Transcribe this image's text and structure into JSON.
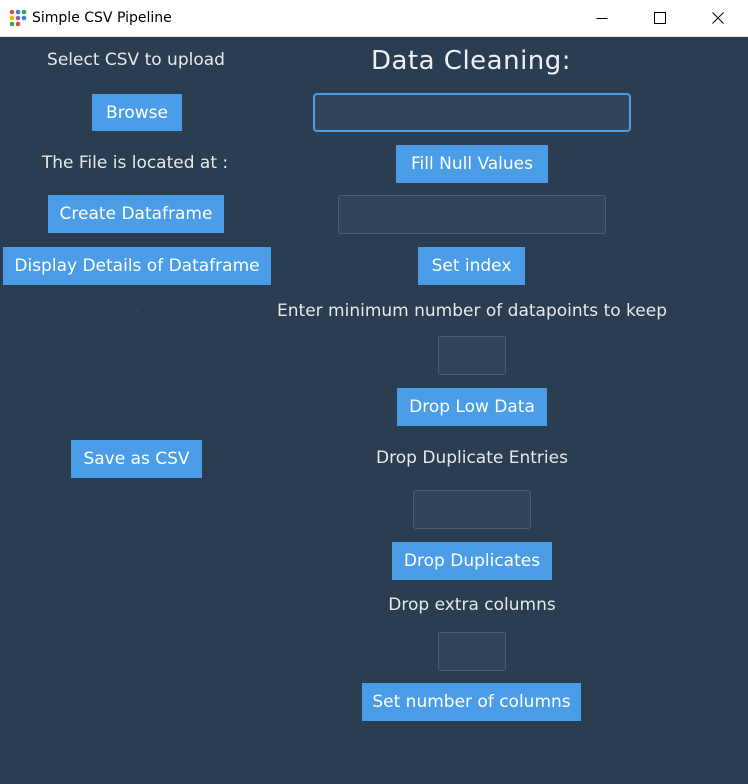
{
  "window": {
    "title": "Simple CSV Pipeline",
    "icon": "colored-dots-app-icon",
    "controls": [
      "minimize",
      "maximize",
      "close"
    ]
  },
  "left_panel": {
    "select_label": "Select CSV to upload",
    "browse_button": "Browse",
    "file_location_label": "The File is located at :",
    "create_dataframe_button": "Create Dataframe",
    "display_details_button": "Display Details of Dataframe",
    "save_csv_button": "Save as CSV"
  },
  "right_panel": {
    "heading": "Data Cleaning:",
    "fill_null_input": {
      "value": "",
      "placeholder": ""
    },
    "fill_null_button": "Fill Null Values",
    "set_index_input": {
      "value": "",
      "placeholder": ""
    },
    "set_index_button": "Set index",
    "min_datapoints_label": "Enter minimum number of datapoints to keep",
    "min_datapoints_input": {
      "value": "",
      "placeholder": ""
    },
    "drop_low_data_button": "Drop Low Data",
    "drop_duplicate_label": "Drop Duplicate Entries",
    "drop_duplicate_input": {
      "value": "",
      "placeholder": ""
    },
    "drop_duplicates_button": "Drop Duplicates",
    "drop_extra_columns_label": "Drop extra columns",
    "extra_columns_input": {
      "value": "",
      "placeholder": ""
    },
    "set_columns_button": "Set number of columns"
  },
  "colors": {
    "background": "#2b3d51",
    "button": "#4a9de6",
    "button_text": "#ffffff",
    "field_background": "#304559",
    "field_border": "#4a5d70",
    "focus_border": "#4a9de6",
    "text": "#e6e9ec"
  }
}
